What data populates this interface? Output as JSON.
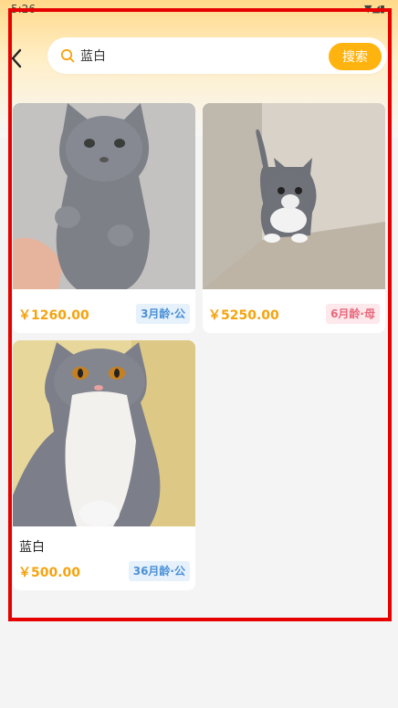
{
  "status": {
    "time": "5:26",
    "icons": "▼◢▮"
  },
  "header": {
    "back_icon": "chevron-left-icon",
    "search": {
      "value": "蓝白",
      "placeholder": "",
      "button_label": "搜索",
      "icon": "search-icon"
    }
  },
  "colors": {
    "accent": "#ffb30f",
    "price": "#f5a30f",
    "male_badge_bg": "#e6f1fc",
    "male_badge_text": "#4a90d6",
    "female_badge_bg": "#fde8ec",
    "female_badge_text": "#e8697c",
    "highlight": "#e60000"
  },
  "cards": [
    {
      "title": "",
      "price": "￥1260.00",
      "badge": "3月龄·公",
      "gender": "male"
    },
    {
      "title": "",
      "price": "￥5250.00",
      "badge": "6月龄·母",
      "gender": "female"
    },
    {
      "title": "蓝白",
      "price": "￥500.00",
      "badge": "36月龄·公",
      "gender": "male"
    }
  ]
}
